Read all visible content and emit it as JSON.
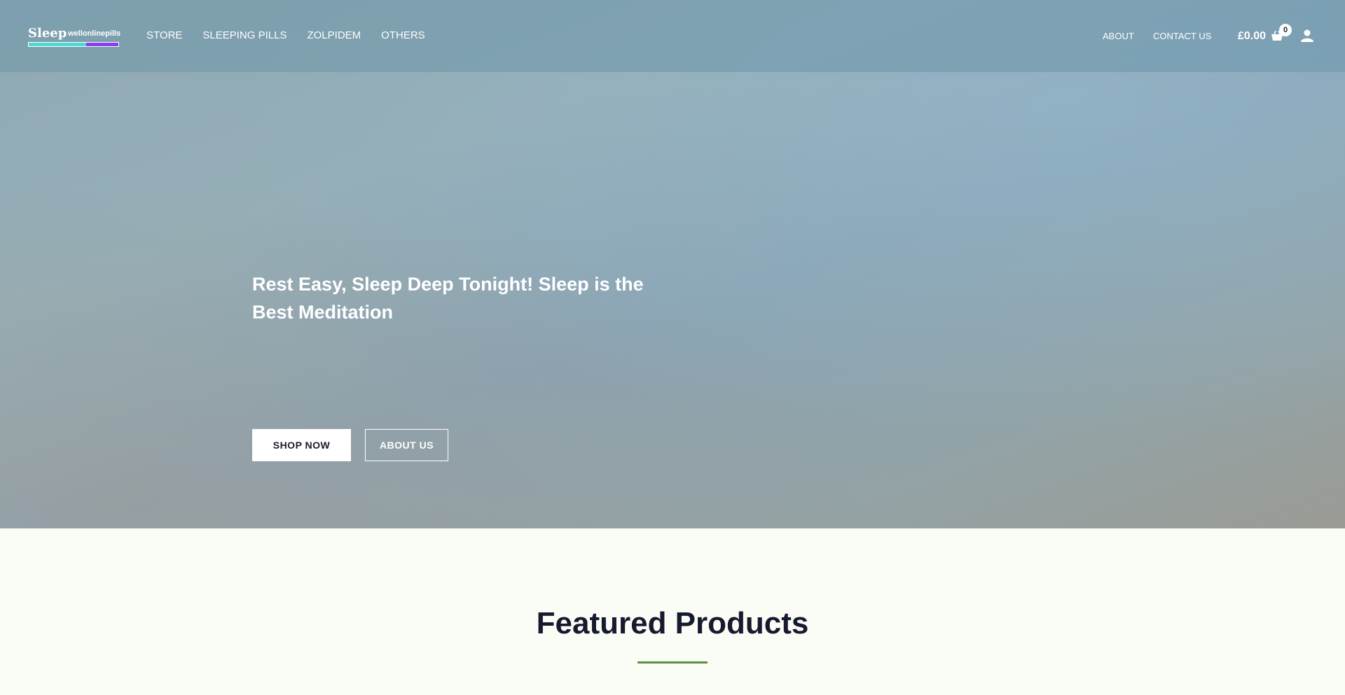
{
  "brand": {
    "logo_word": "Sleep",
    "logo_sub": "wellonlinepills",
    "logo_bar_colors": [
      "#4dd9d4",
      "#8a3ff0"
    ]
  },
  "main_nav": {
    "items": [
      {
        "label": "STORE"
      },
      {
        "label": "SLEEPING PILLS"
      },
      {
        "label": "ZOLPIDEM"
      },
      {
        "label": "OTHERS"
      }
    ]
  },
  "right_nav": {
    "about": "ABOUT",
    "contact": "CONTACT US",
    "cart_total": "£0.00",
    "cart_count": "0",
    "cart_icon": "shopping-basket-icon",
    "user_icon": "user-icon"
  },
  "hero": {
    "headline": "Rest Easy, Sleep Deep Tonight! Sleep is the Best Meditation",
    "primary_button": "SHOP NOW",
    "secondary_button": "ABOUT US"
  },
  "featured": {
    "title": "Featured Products",
    "accent_color": "#5a8f3a"
  }
}
